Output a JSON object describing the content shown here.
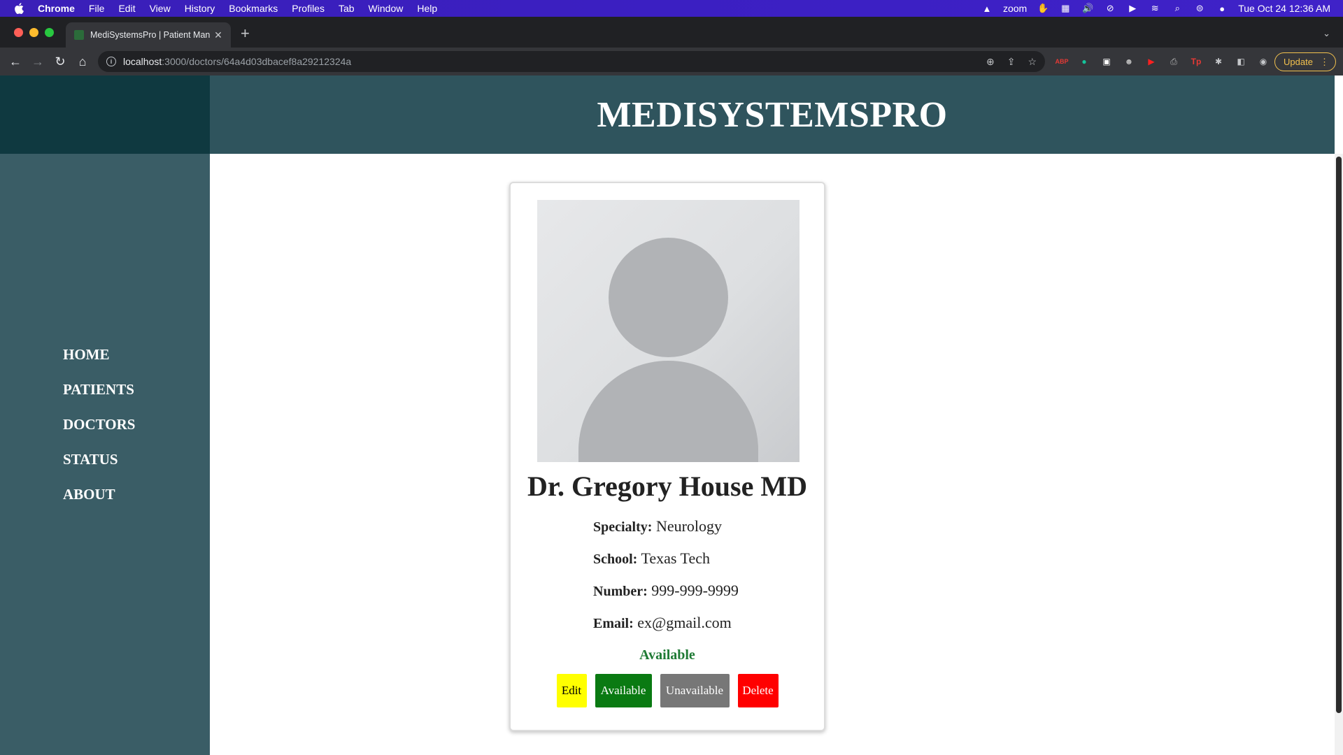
{
  "menubar": {
    "app": "Chrome",
    "items": [
      "File",
      "Edit",
      "View",
      "History",
      "Bookmarks",
      "Profiles",
      "Tab",
      "Window",
      "Help"
    ],
    "zoom_label": "zoom",
    "clock": "Tue Oct 24  12:36 AM"
  },
  "browser": {
    "tab_title": "MediSystemsPro | Patient Man",
    "url_host": "localhost",
    "url_path": ":3000/doctors/64a4d03dbacef8a29212324a",
    "update_label": "Update"
  },
  "page": {
    "site_title": "MEDISYSTEMSPRO",
    "nav": [
      "HOME",
      "PATIENTS",
      "DOCTORS",
      "STATUS",
      "ABOUT"
    ]
  },
  "doctor": {
    "name": "Dr. Gregory House MD",
    "specialty_label": "Specialty:",
    "specialty": "Neurology",
    "school_label": "School:",
    "school": "Texas Tech",
    "number_label": "Number:",
    "number": "999-999-9999",
    "email_label": "Email:",
    "email": "ex@gmail.com",
    "status": "Available"
  },
  "actions": {
    "edit": "Edit",
    "available": "Available",
    "unavailable": "Unavailable",
    "delete": "Delete"
  },
  "colors": {
    "sidebar": "#3a5d66",
    "header": "#2f545d",
    "status_available": "#1e7a34",
    "edit_button": "#ffff00",
    "available_button": "#0a7a12",
    "unavailable_button": "#777777",
    "delete_button": "#ff0000"
  }
}
